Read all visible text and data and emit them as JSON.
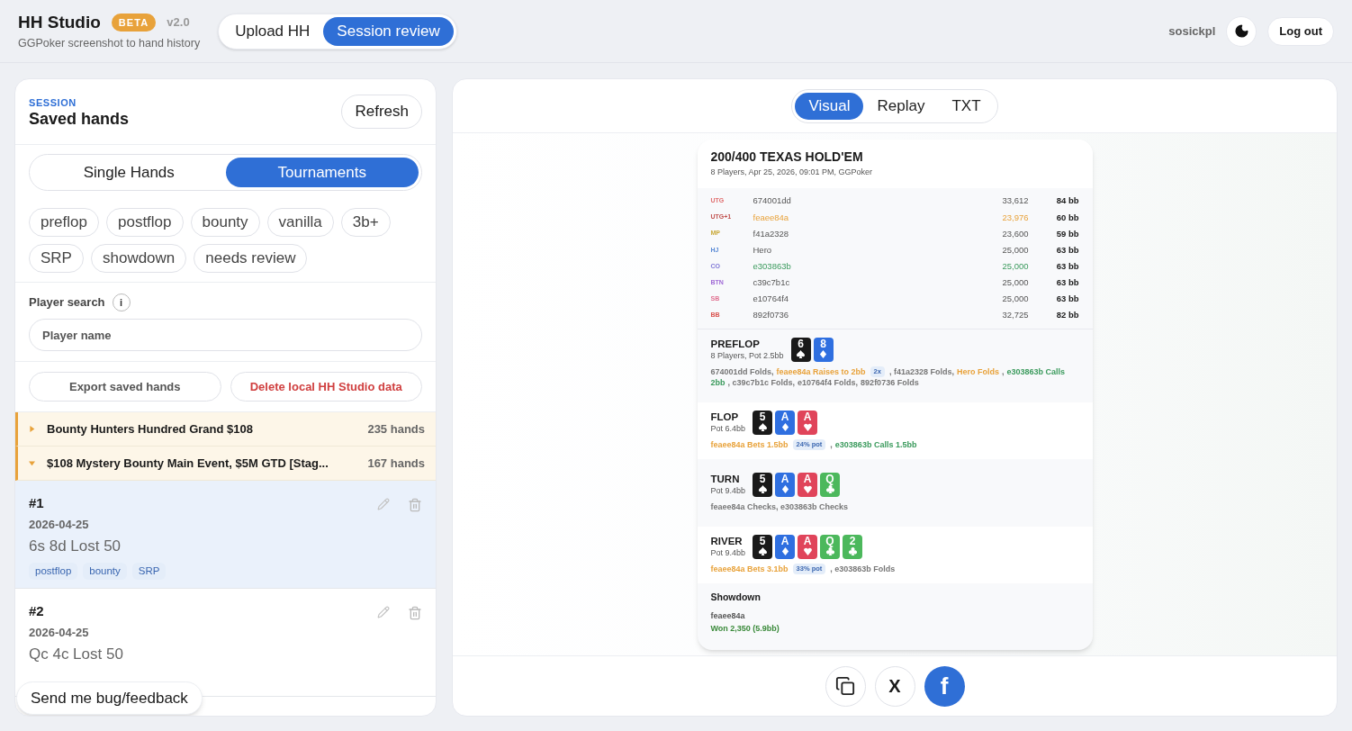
{
  "header": {
    "title": "HH Studio",
    "badge": "BETA",
    "version": "v2.0",
    "subtitle": "GGPoker screenshot to hand history",
    "nav": [
      {
        "label": "Upload HH",
        "selected": false
      },
      {
        "label": "Session review",
        "selected": true
      }
    ],
    "user": "sosickpl",
    "logout": "Log out"
  },
  "sidebar": {
    "eyebrow": "SESSION",
    "title": "Saved hands",
    "refresh": "Refresh",
    "tabs": [
      {
        "label": "Single Hands",
        "selected": false
      },
      {
        "label": "Tournaments",
        "selected": true
      }
    ],
    "filters": [
      {
        "label": "preflop",
        "selected": false
      },
      {
        "label": "postflop",
        "selected": false
      },
      {
        "label": "bounty",
        "selected": false
      },
      {
        "label": "vanilla",
        "selected": false
      },
      {
        "label": "3b+",
        "selected": false
      },
      {
        "label": "SRP",
        "selected": false
      },
      {
        "label": "showdown",
        "selected": false
      },
      {
        "label": "needs review",
        "selected": false
      }
    ],
    "search": {
      "label": "Player search",
      "info": "i",
      "placeholder": "Player name"
    },
    "export": "Export saved hands",
    "delete": "Delete local HH Studio data",
    "tournaments": [
      {
        "name": "Bounty Hunters Hundred Grand $108",
        "count": "235 hands",
        "expanded": false
      },
      {
        "name": "$108 Mystery Bounty Main Event, $5M GTD [Stag...",
        "count": "167 hands",
        "expanded": true
      }
    ],
    "hands": [
      {
        "number": "#1",
        "date": "2026-04-25",
        "result": "6s 8d Lost 50",
        "tags": [
          "postflop",
          "bounty",
          "SRP"
        ],
        "selected": true
      },
      {
        "number": "#2",
        "date": "2026-04-25",
        "result": "Qc 4c Lost 50",
        "selected": false
      }
    ],
    "feedback": "Send me bug/feedback"
  },
  "viewer": {
    "tabs": [
      {
        "label": "Visual",
        "selected": true
      },
      {
        "label": "Replay",
        "selected": false
      },
      {
        "label": "TXT",
        "selected": false
      }
    ],
    "hand": {
      "title": "200/400 TEXAS HOLD'EM",
      "subtitle": "8 Players, Apr 25, 2026, 09:01 PM, GGPoker",
      "players": [
        {
          "position": "UTG",
          "color": "#e06c6c",
          "name": "674001dd",
          "stack": "33,612",
          "bb": "84 bb",
          "kind": "plain"
        },
        {
          "position": "UTG+1",
          "color": "#c0504d",
          "name": "feaee84a",
          "stack": "23,976",
          "bb": "60 bb",
          "kind": "raiser"
        },
        {
          "position": "MP",
          "color": "#c9a93a",
          "name": "f41a2328",
          "stack": "23,600",
          "bb": "59 bb",
          "kind": "plain"
        },
        {
          "position": "HJ",
          "color": "#5b8bd6",
          "name": "Hero",
          "stack": "25,000",
          "bb": "63 bb",
          "kind": "plain"
        },
        {
          "position": "CO",
          "color": "#7f78d6",
          "name": "e303863b",
          "stack": "25,000",
          "bb": "63 bb",
          "kind": "caller"
        },
        {
          "position": "BTN",
          "color": "#a06ad6",
          "name": "c39c7b1c",
          "stack": "25,000",
          "bb": "63 bb",
          "kind": "plain"
        },
        {
          "position": "SB",
          "color": "#e07090",
          "name": "e10764f4",
          "stack": "25,000",
          "bb": "63 bb",
          "kind": "plain"
        },
        {
          "position": "BB",
          "color": "#d9534f",
          "name": "892f0736",
          "stack": "32,725",
          "bb": "82 bb",
          "kind": "plain"
        }
      ],
      "streets": [
        {
          "name": "PREFLOP",
          "pot": "8 Players, Pot 2.5bb",
          "cards": [
            {
              "rank": "6",
              "kind": "spades"
            },
            {
              "rank": "8",
              "kind": "diamonds"
            }
          ],
          "actions": [
            {
              "kind": "fold",
              "text": "674001dd Folds,"
            },
            {
              "kind": "raise",
              "text": "feaee84a Raises to 2bb"
            },
            {
              "kind": "badge",
              "text": "2x"
            },
            {
              "kind": "fold",
              "text": ", f41a2328 Folds,"
            },
            {
              "kind": "raise",
              "text": "Hero Folds"
            },
            {
              "kind": "fold",
              "text": ","
            },
            {
              "kind": "call",
              "text": "e303863b Calls"
            },
            {
              "kind": "call",
              "text": "2bb"
            },
            {
              "kind": "fold",
              "text": ", c39c7b1c Folds,"
            },
            {
              "kind": "fold",
              "text": "e10764f4 Folds,"
            },
            {
              "kind": "fold",
              "text": "892f0736 Folds"
            }
          ]
        },
        {
          "name": "FLOP",
          "pot": "Pot 6.4bb",
          "cards": [
            {
              "rank": "5",
              "kind": "spades"
            },
            {
              "rank": "A",
              "kind": "diamonds"
            },
            {
              "rank": "A",
              "kind": "hearts"
            }
          ],
          "actions": [
            {
              "kind": "raise",
              "text": "feaee84a Bets 1.5bb"
            },
            {
              "kind": "badge",
              "text": "24% pot"
            },
            {
              "kind": "fold",
              "text": ","
            },
            {
              "kind": "call",
              "text": "e303863b Calls 1.5bb"
            }
          ]
        },
        {
          "name": "TURN",
          "pot": "Pot 9.4bb",
          "cards": [
            {
              "rank": "5",
              "kind": "spades"
            },
            {
              "rank": "A",
              "kind": "diamonds"
            },
            {
              "rank": "A",
              "kind": "hearts"
            },
            {
              "rank": "Q",
              "kind": "clubs"
            }
          ],
          "actions": [
            {
              "kind": "fold",
              "text": "feaee84a Checks, e303863b Checks"
            }
          ]
        },
        {
          "name": "RIVER",
          "pot": "Pot 9.4bb",
          "cards": [
            {
              "rank": "5",
              "kind": "spades"
            },
            {
              "rank": "A",
              "kind": "diamonds"
            },
            {
              "rank": "A",
              "kind": "hearts"
            },
            {
              "rank": "Q",
              "kind": "clubs"
            },
            {
              "rank": "2",
              "kind": "clubs"
            }
          ],
          "actions": [
            {
              "kind": "raise",
              "text": "feaee84a Bets 3.1bb"
            },
            {
              "kind": "badge",
              "text": "33% pot"
            },
            {
              "kind": "fold",
              "text": ", e303863b Folds"
            }
          ]
        }
      ],
      "showdown": {
        "title": "Showdown",
        "player": "feaee84a",
        "result": "Won 2,350 (5.9bb)"
      }
    },
    "share": {
      "x": "X",
      "facebook": "f"
    }
  }
}
